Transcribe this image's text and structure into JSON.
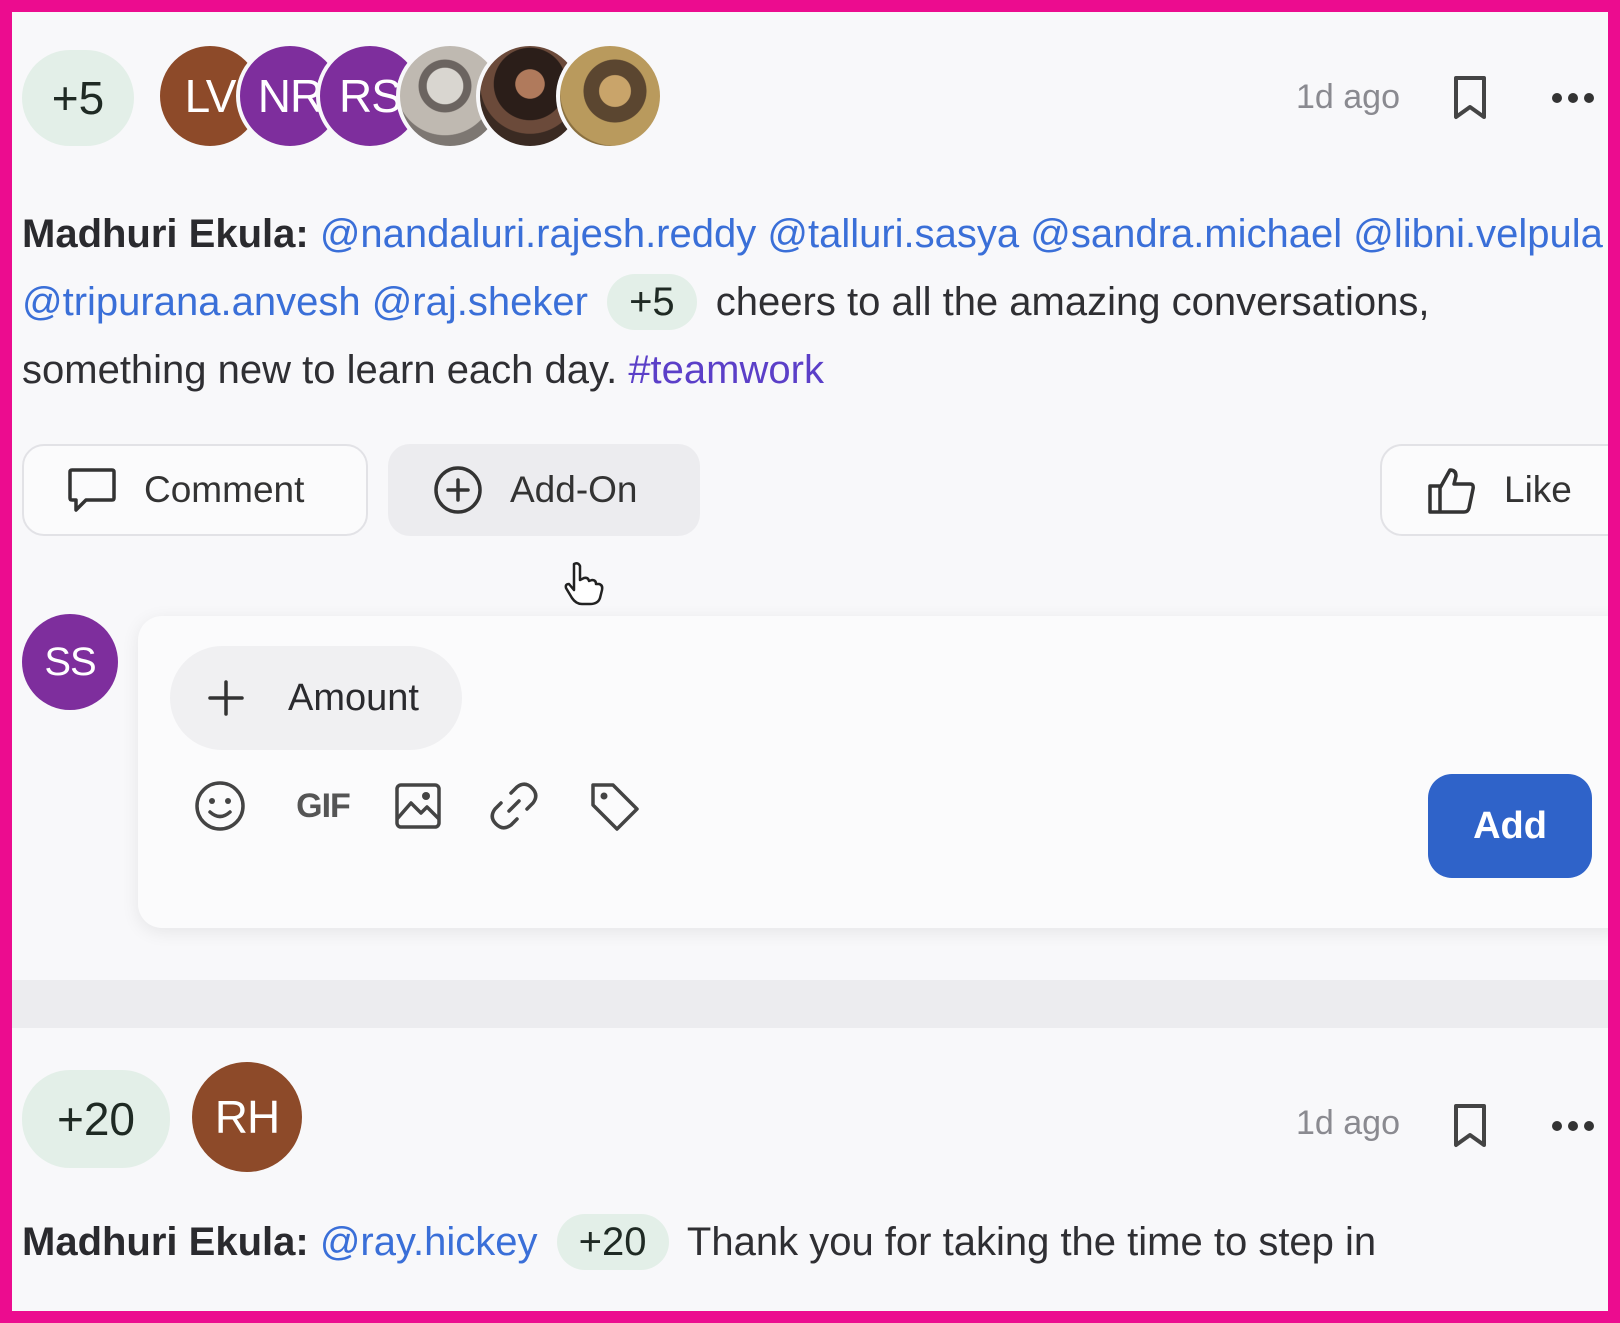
{
  "post1": {
    "points": "+5",
    "avatars": [
      {
        "initials": "LV",
        "color": "#8d4a29"
      },
      {
        "initials": "NR",
        "color": "#7e2e9d"
      },
      {
        "initials": "RS",
        "color": "#7e2e9d"
      },
      {
        "initials": "",
        "photo": true
      },
      {
        "initials": "",
        "photo": true
      },
      {
        "initials": "",
        "photo": true
      }
    ],
    "timestamp": "1d ago",
    "author": "Madhuri Ekula:",
    "mentions": [
      "@nandaluri.rajesh.reddy",
      "@talluri.sasya",
      "@sandra.michael",
      "@libni.velpula",
      "@tripurana.anvesh",
      "@raj.sheker"
    ],
    "inline_points": "+5",
    "message": "cheers to all the amazing conversations, something new to learn each day.",
    "hashtag": "#teamwork",
    "actions": {
      "comment": "Comment",
      "addon": "Add-On",
      "like": "Like"
    }
  },
  "composer": {
    "user_initials": "SS",
    "amount_label": "Amount",
    "gif_label": "GIF",
    "add_label": "Add"
  },
  "post2": {
    "points": "+20",
    "avatar_initials": "RH",
    "timestamp": "1d ago",
    "author": "Madhuri Ekula:",
    "mention": "@ray.hickey",
    "inline_points": "+20",
    "message": "Thank you for taking the time to step in"
  },
  "colors": {
    "frame": "#ec0c8f",
    "mention": "#3a6fd8",
    "hashtag": "#5b3fc8",
    "points_badge": "#e3efe8",
    "add_button": "#2f63c9"
  },
  "icons": [
    "bookmark-icon",
    "more-icon",
    "comment-icon",
    "plus-circle-icon",
    "thumbs-up-icon",
    "plus-icon",
    "emoji-icon",
    "image-icon",
    "link-icon",
    "tag-icon",
    "hand-cursor-icon"
  ]
}
